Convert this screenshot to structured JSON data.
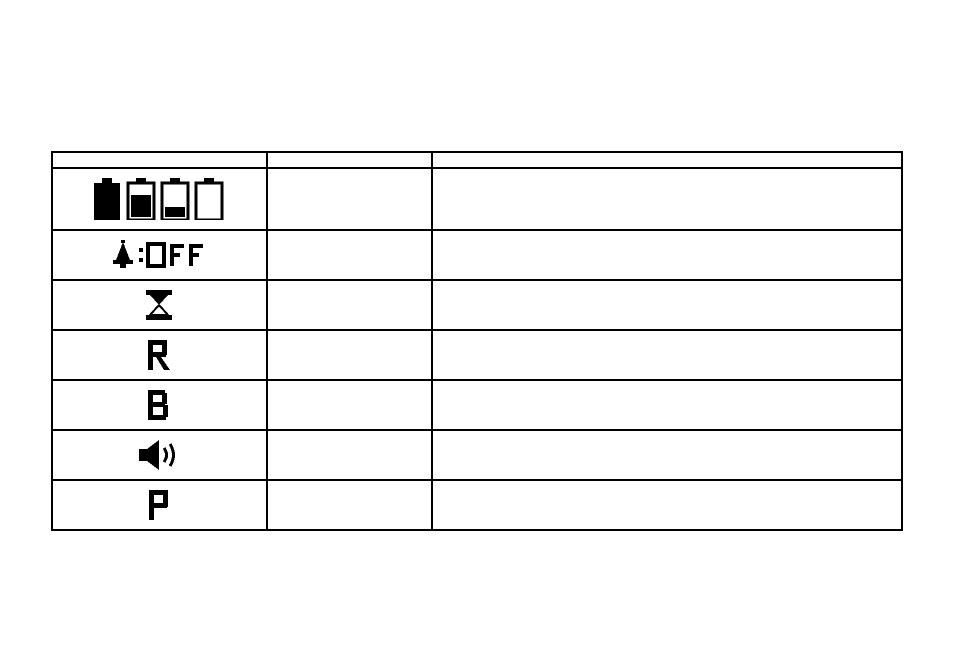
{
  "table": {
    "rows": [
      {
        "icon": "battery-levels-icon",
        "col2": "",
        "col3": ""
      },
      {
        "icon": "bell-off-icon",
        "col2": "",
        "col3": ""
      },
      {
        "icon": "timer-icon",
        "col2": "",
        "col3": ""
      },
      {
        "icon": "letter-R-icon",
        "col2": "",
        "col3": ""
      },
      {
        "icon": "letter-B-icon",
        "col2": "",
        "col3": ""
      },
      {
        "icon": "speaker-icon",
        "col2": "",
        "col3": ""
      },
      {
        "icon": "letter-P-icon",
        "col2": "",
        "col3": ""
      }
    ]
  }
}
